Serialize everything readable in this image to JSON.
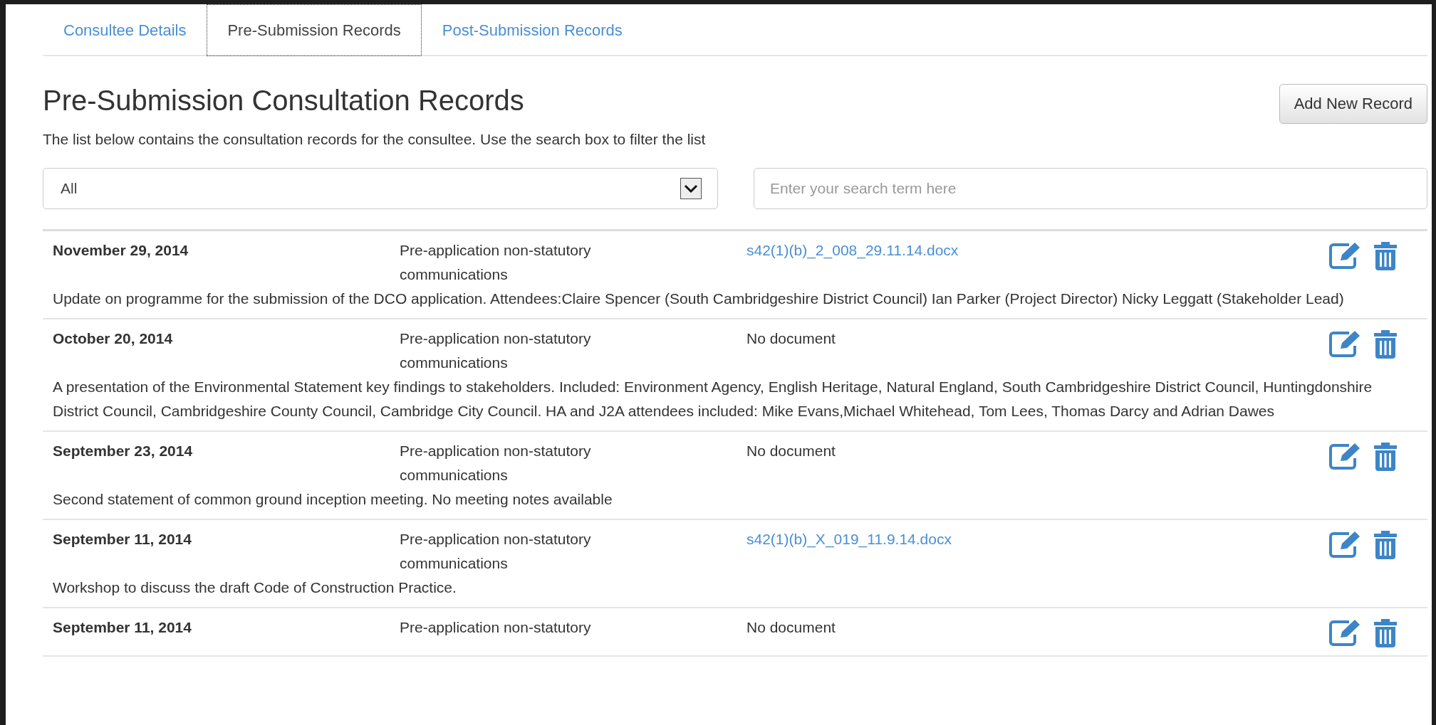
{
  "tabs": [
    {
      "label": "Consultee Details",
      "selected": false
    },
    {
      "label": "Pre-Submission Records",
      "selected": true
    },
    {
      "label": "Post-Submission Records",
      "selected": false
    }
  ],
  "heading": "Pre-Submission Consultation Records",
  "add_button": "Add New Record",
  "description": "The list below contains the consultation records for the consultee. Use the search box to filter the list",
  "filter": {
    "value": "All"
  },
  "search": {
    "placeholder": "Enter your search term here"
  },
  "records": [
    {
      "date": "November 29, 2014",
      "category": "Pre-application non-statutory communications",
      "document": {
        "kind": "link",
        "text": "s42(1)(b)_2_008_29.11.14.docx"
      },
      "notes": "Update on programme for the submission of the DCO application. Attendees:Claire Spencer (South Cambridgeshire District Council) Ian Parker (Project Director) Nicky Leggatt (Stakeholder Lead)"
    },
    {
      "date": "October 20, 2014",
      "category": "Pre-application non-statutory communications",
      "document": {
        "kind": "none",
        "text": "No document"
      },
      "notes": "A presentation of the Environmental Statement key findings to stakeholders. Included: Environment Agency, English Heritage, Natural England, South Cambridgeshire District Council, Huntingdonshire District Council, Cambridgeshire County Council, Cambridge City Council. HA and J2A attendees included: Mike Evans,Michael Whitehead, Tom Lees, Thomas Darcy and Adrian Dawes"
    },
    {
      "date": "September 23, 2014",
      "category": "Pre-application non-statutory communications",
      "document": {
        "kind": "none",
        "text": "No document"
      },
      "notes": "Second statement of common ground inception meeting. No meeting notes available"
    },
    {
      "date": "September 11, 2014",
      "category": "Pre-application non-statutory communications",
      "document": {
        "kind": "link",
        "text": "s42(1)(b)_X_019_11.9.14.docx"
      },
      "notes": "Workshop to discuss the draft Code of Construction Practice."
    },
    {
      "date": "September 11, 2014",
      "category": "Pre-application non-statutory",
      "document": {
        "kind": "none",
        "text": "No document"
      }
    }
  ]
}
